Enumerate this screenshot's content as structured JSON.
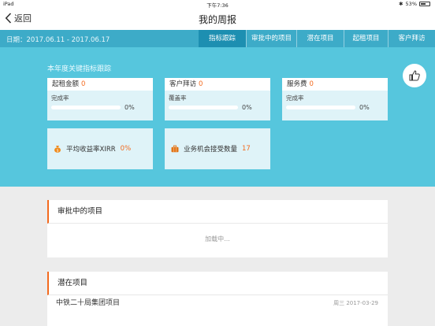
{
  "status": {
    "device": "iPad",
    "time": "下午7:36",
    "battery": "53%"
  },
  "nav": {
    "back_label": "返回",
    "title": "我的周报"
  },
  "tabbar": {
    "date_range": "日期：2017.06.11 - 2017.06.17",
    "tabs": [
      "指标跟踪",
      "审批中的项目",
      "潜在项目",
      "起租项目",
      "客户拜访"
    ],
    "active_index": 0
  },
  "kpi": {
    "title": "本年度关键指标跟踪",
    "cards": [
      {
        "label": "起租金额",
        "value": "0",
        "sub": "完成率",
        "progress_pct": "0%",
        "progress": 0
      },
      {
        "label": "客户拜访",
        "value": "0",
        "sub": "覆盖率",
        "progress_pct": "0%",
        "progress": 0
      },
      {
        "label": "服务费",
        "value": "0",
        "sub": "完成率",
        "progress_pct": "0%",
        "progress": 0
      }
    ],
    "stats": [
      {
        "label": "平均收益率XIRR",
        "value": "0%",
        "icon": "money-bag-icon"
      },
      {
        "label": "业务机会接受数量",
        "value": "17",
        "icon": "briefcase-icon"
      }
    ]
  },
  "sections": {
    "approval": {
      "title": "审批中的项目",
      "loading": "加载中..."
    },
    "potential": {
      "title": "潜在项目",
      "items": [
        {
          "name": "中铁二十局集团项目",
          "date": "周三 2017-03-29"
        }
      ]
    }
  },
  "colors": {
    "accent": "#56c6dd",
    "tab_bg": "#3dabc8",
    "tab_active": "#1d8fb1",
    "highlight": "#f36a1e"
  }
}
